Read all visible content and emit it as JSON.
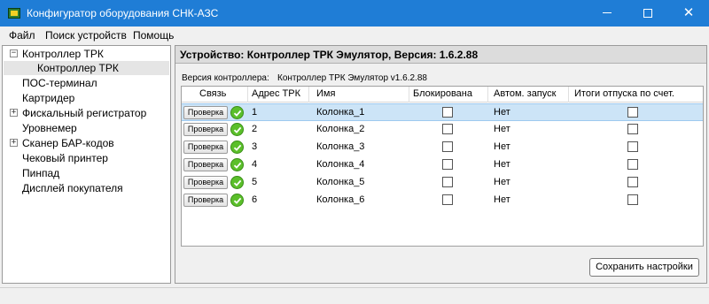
{
  "window": {
    "title": "Конфигуратор оборудования СНК-АЗС",
    "controls": {
      "minimize": "—",
      "maximize": "☐",
      "close": "✕"
    }
  },
  "menu": [
    "Файл",
    "Поиск устройств",
    "Помощь"
  ],
  "tree": [
    {
      "label": "Контроллер ТРК",
      "expander": "−"
    },
    {
      "label": "Контроллер ТРК",
      "selected": true
    },
    {
      "label": "ПОС-терминал"
    },
    {
      "label": "Картридер"
    },
    {
      "label": "Фискальный регистратор",
      "expander": "+"
    },
    {
      "label": "Уровнемер"
    },
    {
      "label": "Сканер БАР-кодов",
      "expander": "+"
    },
    {
      "label": "Чековый принтер"
    },
    {
      "label": "Пинпад"
    },
    {
      "label": "Дисплей покупателя"
    }
  ],
  "panel": {
    "header": "Устройство: Контроллер ТРК Эмулятор, Версия: 1.6.2.88",
    "version_label": "Версия контроллера:",
    "version_value": "Контроллер ТРК Эмулятор v1.6.2.88",
    "save_label": "Сохранить настройки"
  },
  "grid": {
    "columns": [
      "Связь",
      "Адрес ТРК",
      "Имя",
      "Блокирована",
      "Автом. запуск",
      "Итоги отпуска по счет."
    ],
    "check_label": "Проверка",
    "rows": [
      {
        "address": "1",
        "name": "Колонка_1",
        "blocked": false,
        "autostart": "Нет",
        "totals": false,
        "status": "ok-icon"
      },
      {
        "address": "2",
        "name": "Колонка_2",
        "blocked": false,
        "autostart": "Нет",
        "totals": false,
        "status": "ok-icon"
      },
      {
        "address": "3",
        "name": "Колонка_3",
        "blocked": false,
        "autostart": "Нет",
        "totals": false,
        "status": "ok-icon"
      },
      {
        "address": "4",
        "name": "Колонка_4",
        "blocked": false,
        "autostart": "Нет",
        "totals": false,
        "status": "ok-icon"
      },
      {
        "address": "5",
        "name": "Колонка_5",
        "blocked": false,
        "autostart": "Нет",
        "totals": false,
        "status": "ok-icon"
      },
      {
        "address": "6",
        "name": "Колонка_6",
        "blocked": false,
        "autostart": "Нет",
        "totals": false,
        "status": "ok-icon"
      }
    ]
  },
  "colors": {
    "titlebar": "#1f7dd6",
    "row_highlight": "#cce4f7",
    "ok_green": "#5bbf2a"
  }
}
